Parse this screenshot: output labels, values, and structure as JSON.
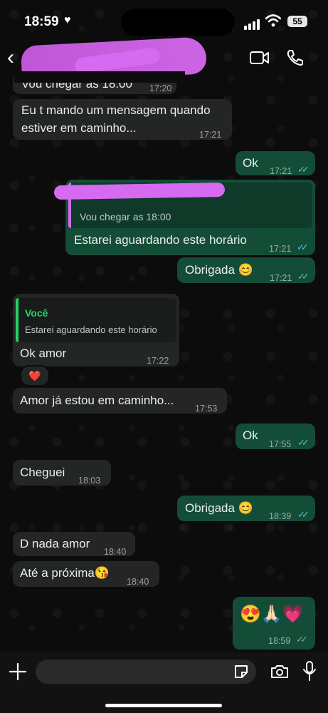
{
  "status_bar": {
    "time": "18:59",
    "battery": "55"
  },
  "header": {
    "back_glyph": "‹"
  },
  "messages": [
    {
      "id": "m0",
      "dir": "in",
      "text": "Vou chegar as 18:00",
      "time": "17:20"
    },
    {
      "id": "m1",
      "dir": "in",
      "lines": [
        "Eu t mando um mensagem quando",
        "estiver em caminho..."
      ],
      "time": "17:21"
    },
    {
      "id": "m2",
      "dir": "out",
      "text": "Ok",
      "time": "17:21"
    },
    {
      "id": "m3",
      "dir": "out",
      "quote_text": "Vou chegar as 18:00",
      "text": "Estarei aguardando este horário",
      "time": "17:21"
    },
    {
      "id": "m4",
      "dir": "out",
      "text": "Obrigada 😊",
      "time": "17:21"
    },
    {
      "id": "m5",
      "dir": "in",
      "quote_author": "Você",
      "quote_text": "Estarei aguardando este horário",
      "text": "Ok amor",
      "time": "17:22",
      "reaction": "❤️"
    },
    {
      "id": "m6",
      "dir": "in",
      "text": "Amor já estou em caminho...",
      "time": "17:53"
    },
    {
      "id": "m7",
      "dir": "out",
      "text": "Ok",
      "time": "17:55"
    },
    {
      "id": "m8",
      "dir": "in",
      "text": "Cheguei",
      "time": "18:03"
    },
    {
      "id": "m9",
      "dir": "out",
      "text": "Obrigada 😊",
      "time": "18:39"
    },
    {
      "id": "m10",
      "dir": "in",
      "text": "D nada amor",
      "time": "18:40"
    },
    {
      "id": "m11",
      "dir": "in",
      "text": "Até a próxima😘",
      "time": "18:40"
    },
    {
      "id": "m12",
      "dir": "out",
      "text": "😍🙏🏻💗",
      "time": "18:59"
    }
  ],
  "colors": {
    "bubble_in": "#242626",
    "bubble_out": "#144d37",
    "read_ticks": "#53bdeb",
    "quote_accent_in": "#25d366",
    "redaction": "#d66af0"
  },
  "icons": [
    "back-icon",
    "video-call-icon",
    "voice-call-icon",
    "plus-icon",
    "sticker-icon",
    "camera-icon",
    "mic-icon",
    "read-ticks-icon"
  ]
}
